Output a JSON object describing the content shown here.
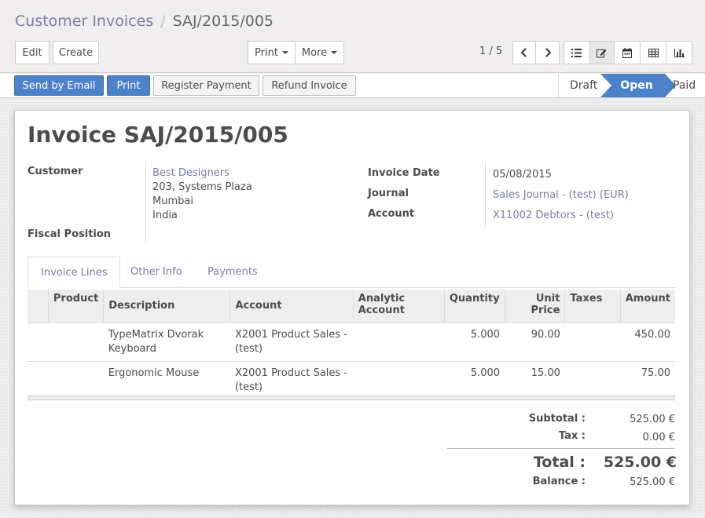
{
  "breadcrumb": {
    "parent": "Customer Invoices",
    "separator": "/",
    "current": "SAJ/2015/005"
  },
  "toolbar": {
    "edit_label": "Edit",
    "create_label": "Create",
    "print_label": "Print",
    "more_label": "More"
  },
  "pager": {
    "value": "1 / 5"
  },
  "statusbar": {
    "buttons": [
      "Send by Email",
      "Print",
      "Register Payment",
      "Refund Invoice"
    ],
    "stages": [
      "Draft",
      "Open",
      "Paid"
    ],
    "active_stage": "Open"
  },
  "colors": {
    "primary": "#4c82c9",
    "link": "#7c7bad"
  },
  "invoice": {
    "title": "Invoice SAJ/2015/005",
    "customer_label": "Customer",
    "customer_name": "Best Designers",
    "address": [
      "203, Systems Plaza",
      "Mumbai",
      "India"
    ],
    "fiscal_position_label": "Fiscal Position",
    "invoice_date_label": "Invoice Date",
    "invoice_date": "05/08/2015",
    "journal_label": "Journal",
    "journal": "Sales Journal - (test) (EUR)",
    "account_label": "Account",
    "account": "X11002 Debtors - (test)"
  },
  "tabs": [
    "Invoice Lines",
    "Other Info",
    "Payments"
  ],
  "lines": {
    "headers": [
      "Product",
      "Description",
      "Account",
      "Analytic Account",
      "Quantity",
      "Unit Price",
      "Taxes",
      "Amount"
    ],
    "rows": [
      {
        "product": "",
        "description": "TypeMatrix Dvorak Keyboard",
        "account": "X2001 Product Sales - (test)",
        "analytic": "",
        "quantity": "5.000",
        "unit_price": "90.00",
        "taxes": "",
        "amount": "450.00"
      },
      {
        "product": "",
        "description": "Ergonomic Mouse",
        "account": "X2001 Product Sales - (test)",
        "analytic": "",
        "quantity": "5.000",
        "unit_price": "15.00",
        "taxes": "",
        "amount": "75.00"
      }
    ]
  },
  "totals": {
    "subtotal_label": "Subtotal :",
    "subtotal": "525.00 €",
    "tax_label": "Tax :",
    "tax": "0.00 €",
    "total_label": "Total :",
    "total": "525.00 €",
    "balance_label": "Balance :",
    "balance": "525.00 €"
  }
}
